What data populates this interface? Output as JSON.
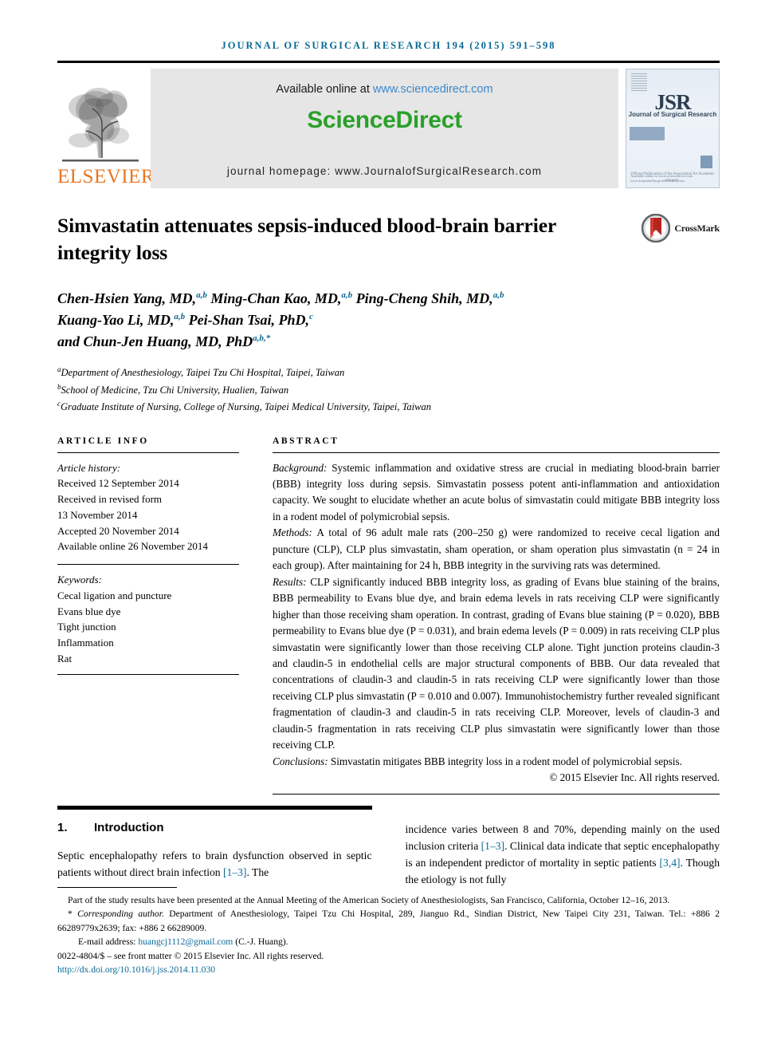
{
  "running_head": "JOURNAL OF SURGICAL RESEARCH 194 (2015) 591–598",
  "masthead": {
    "publisher_name": "ELSEVIER",
    "available_prefix": "Available online at ",
    "available_link": "www.sciencedirect.com",
    "sciencedirect_logo": "ScienceDirect",
    "journal_homepage": "journal homepage: www.JournalofSurgicalResearch.com",
    "cover": {
      "title": "JSR",
      "subtitle": "Journal of Surgical Research",
      "note": "Official Publication of the\nAssociation for Academic Surgery",
      "footer": "Available online at www.sciencedirect.com\nwww.JournalofSurgicalResearch.com"
    }
  },
  "article": {
    "title": "Simvastatin attenuates sepsis-induced blood-brain barrier integrity loss",
    "crossmark_label": "CrossMark",
    "authors_line1": "Chen-Hsien Yang, MD,",
    "authors_line1_sup1": "a,b",
    "authors_line1_b": " Ming-Chan Kao, MD,",
    "authors_line1_sup2": "a,b",
    "authors_line1_c": " Ping-Cheng Shih, MD,",
    "authors_line1_sup3": "a,b",
    "authors_line2": "Kuang-Yao Li, MD,",
    "authors_line2_sup1": "a,b",
    "authors_line2_b": " Pei-Shan Tsai, PhD,",
    "authors_line2_sup2": "c",
    "authors_line3": "and Chun-Jen Huang, MD, PhD",
    "authors_line3_sup": "a,b,*",
    "affiliations": [
      {
        "marker": "a",
        "text": "Department of Anesthesiology, Taipei Tzu Chi Hospital, Taipei, Taiwan"
      },
      {
        "marker": "b",
        "text": "School of Medicine, Tzu Chi University, Hualien, Taiwan"
      },
      {
        "marker": "c",
        "text": "Graduate Institute of Nursing, College of Nursing, Taipei Medical University, Taipei, Taiwan"
      }
    ]
  },
  "article_info": {
    "heading": "ARTICLE INFO",
    "history_label": "Article history:",
    "history": [
      "Received 12 September 2014",
      "Received in revised form",
      "13 November 2014",
      "Accepted 20 November 2014",
      "Available online 26 November 2014"
    ],
    "keywords_label": "Keywords:",
    "keywords": [
      "Cecal ligation and puncture",
      "Evans blue dye",
      "Tight junction",
      "Inflammation",
      "Rat"
    ]
  },
  "abstract": {
    "heading": "ABSTRACT",
    "background_label": "Background:",
    "background": " Systemic inflammation and oxidative stress are crucial in mediating blood-brain barrier (BBB) integrity loss during sepsis. Simvastatin possess potent anti-inflammation and antioxidation capacity. We sought to elucidate whether an acute bolus of simvastatin could mitigate BBB integrity loss in a rodent model of polymicrobial sepsis.",
    "methods_label": "Methods:",
    "methods": " A total of 96 adult male rats (200–250 g) were randomized to receive cecal ligation and puncture (CLP), CLP plus simvastatin, sham operation, or sham operation plus simvastatin (n = 24 in each group). After maintaining for 24 h, BBB integrity in the surviving rats was determined.",
    "results_label": "Results:",
    "results": " CLP significantly induced BBB integrity loss, as grading of Evans blue staining of the brains, BBB permeability to Evans blue dye, and brain edema levels in rats receiving CLP were significantly higher than those receiving sham operation. In contrast, grading of Evans blue staining (P = 0.020), BBB permeability to Evans blue dye (P = 0.031), and brain edema levels (P = 0.009) in rats receiving CLP plus simvastatin were significantly lower than those receiving CLP alone. Tight junction proteins claudin-3 and claudin-5 in endothelial cells are major structural components of BBB. Our data revealed that concentrations of claudin-3 and claudin-5 in rats receiving CLP were significantly lower than those receiving CLP plus simvastatin (P = 0.010 and 0.007). Immunohistochemistry further revealed significant fragmentation of claudin-3 and claudin-5 in rats receiving CLP. Moreover, levels of claudin-3 and claudin-5 fragmentation in rats receiving CLP plus simvastatin were significantly lower than those receiving CLP.",
    "conclusions_label": "Conclusions:",
    "conclusions": " Simvastatin mitigates BBB integrity loss in a rodent model of polymicrobial sepsis.",
    "copyright": "© 2015 Elsevier Inc. All rights reserved."
  },
  "introduction": {
    "number": "1.",
    "heading": "Introduction",
    "left_part1": "Septic encephalopathy refers to brain dysfunction observed in septic patients without direct brain infection ",
    "left_ref1": "[1–3]",
    "left_part2": ". The",
    "right_part1": "incidence varies between 8 and 70%, depending mainly on the used inclusion criteria ",
    "right_ref1": "[1–3]",
    "right_part2": ". Clinical data indicate that septic encephalopathy is an independent predictor of mortality in septic patients ",
    "right_ref2": "[3,4]",
    "right_part3": ". Though the etiology is not fully"
  },
  "footnotes": {
    "presented": "Part of the study results have been presented at the Annual Meeting of the American Society of Anesthesiologists, San Francisco, California, October 12–16, 2013.",
    "corresponding_marker": "*",
    "corresponding_label": "Corresponding author.",
    "corresponding_text": " Department of Anesthesiology, Taipei Tzu Chi Hospital, 289, Jianguo Rd., Sindian District, New Taipei City 231, Taiwan. Tel.: +886 2 66289779x2639; fax: +886 2 66289009.",
    "email_label": "E-mail address: ",
    "email": "huangcj1112@gmail.com",
    "email_suffix": " (C.-J. Huang).",
    "issn_line": "0022-4804/$ – see front matter © 2015 Elsevier Inc. All rights reserved.",
    "doi": "http://dx.doi.org/10.1016/j.jss.2014.11.030"
  },
  "colors": {
    "accent_blue": "#0a6a96",
    "link_blue": "#3d87c9",
    "sciencedirect_green": "#2aa02a",
    "elsevier_orange": "#e87722",
    "crossmark_red": "#b5241f"
  }
}
